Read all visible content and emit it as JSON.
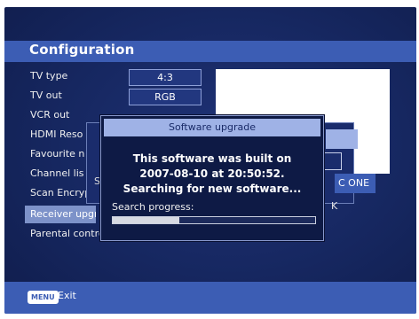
{
  "page": {
    "title": "Configuration"
  },
  "menu": {
    "items": [
      {
        "label": "TV type"
      },
      {
        "label": "TV out"
      },
      {
        "label": "VCR out"
      },
      {
        "label": "HDMI Reso"
      },
      {
        "label": "Favourite n"
      },
      {
        "label": "Channel lis"
      },
      {
        "label": "Scan Encryp"
      },
      {
        "label": "Receiver upgr"
      },
      {
        "label": "Parental control..."
      }
    ],
    "selected_index": 7
  },
  "values": {
    "tv_type": "4:3",
    "tv_out": "RGB"
  },
  "background_panel": {
    "label": "C ONE",
    "letter_s": "S",
    "letter_k": "K"
  },
  "dialog": {
    "title": "Software upgrade",
    "message_line1": "This software was built on",
    "message_line2": "2007-08-10 at 20:50:52.",
    "message_line3": "Searching for new software...",
    "progress_label": "Search progress:",
    "progress_fraction": 0.33
  },
  "footer": {
    "menu_key": "MENU",
    "exit_label": "Exit"
  },
  "colors": {
    "accent": "#3c5db4",
    "background": "#162760",
    "selected": "#7d92c9",
    "dialog_title_bg": "#9fb2e6"
  }
}
